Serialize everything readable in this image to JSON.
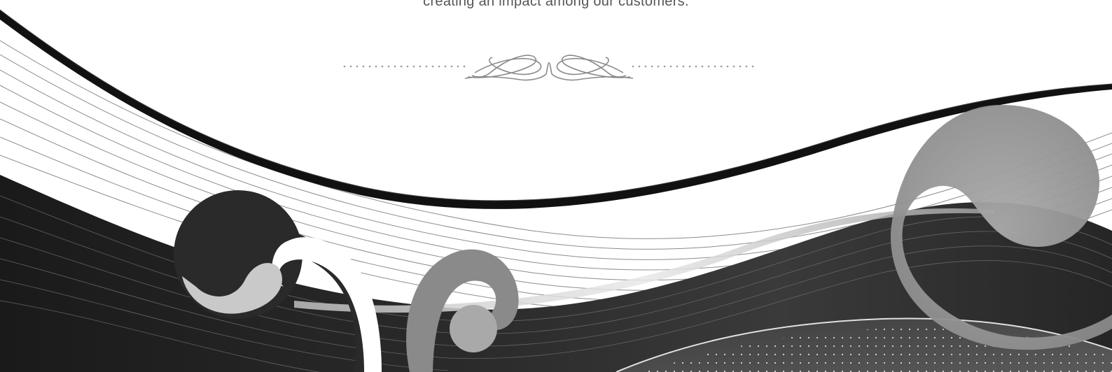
{
  "hero": {
    "tagline": "creating an impact among our customers."
  }
}
